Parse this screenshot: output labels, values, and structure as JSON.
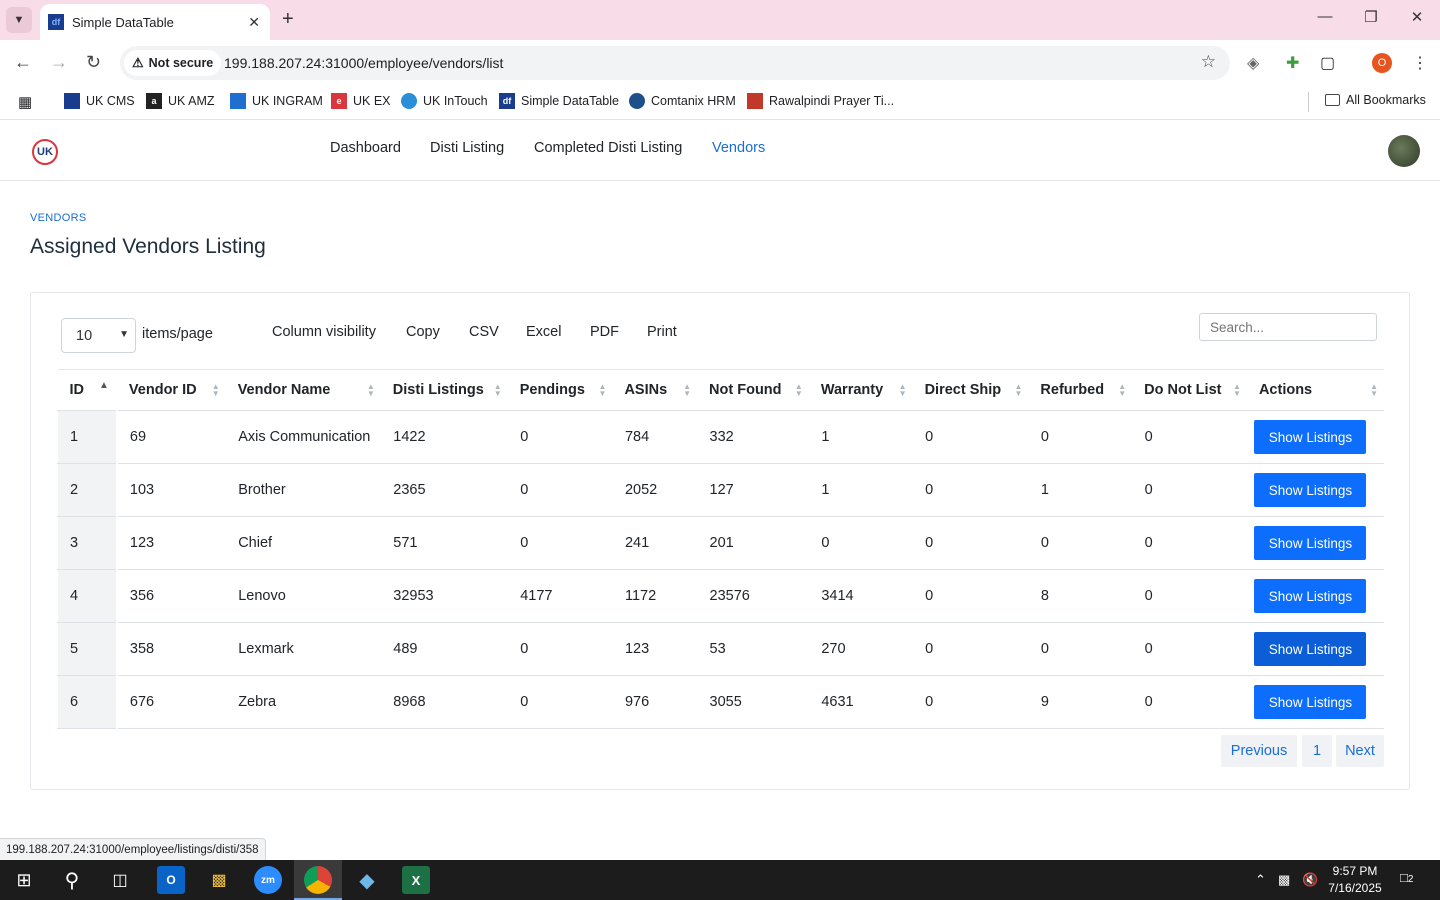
{
  "browser": {
    "tab_title": "Simple DataTable",
    "favicon_text": "df",
    "security_label": "Not secure",
    "url": "199.188.207.24:31000/employee/vendors/list",
    "profile_initial": "O",
    "bookmarks": [
      {
        "label": "UK CMS",
        "color": "#1a3c8c"
      },
      {
        "label": "UK AMZ",
        "color": "#222222"
      },
      {
        "label": "UK INGRAM",
        "color": "#1e6fd0"
      },
      {
        "label": "UK EX",
        "color": "#d9363e"
      },
      {
        "label": "UK InTouch",
        "color": "#2a8fd6"
      },
      {
        "label": "Simple DataTable",
        "color": "#1a3c8c"
      },
      {
        "label": "Comtanix HRM",
        "color": "#1d4f8a"
      },
      {
        "label": "Rawalpindi Prayer Ti...",
        "color": "#c0392b"
      }
    ],
    "all_bookmarks_label": "All Bookmarks",
    "status_url": "199.188.207.24:31000/employee/listings/disti/358"
  },
  "app": {
    "logo_text": "UK",
    "nav": [
      "Dashboard",
      "Disti Listing",
      "Completed Disti Listing",
      "Vendors"
    ],
    "active_nav": "Vendors",
    "accent_color": "#1a6dd6"
  },
  "page": {
    "breadcrumb": "VENDORS",
    "title": "Assigned Vendors Listing"
  },
  "table_controls": {
    "per_page_value": "10",
    "per_page_label": "items/page",
    "tools": [
      "Column visibility",
      "Copy",
      "CSV",
      "Excel",
      "PDF",
      "Print"
    ],
    "search_placeholder": "Search..."
  },
  "table": {
    "columns": [
      "ID",
      "Vendor ID",
      "Vendor Name",
      "Disti Listings",
      "Pendings",
      "ASINs",
      "Not Found",
      "Warranty",
      "Direct Ship",
      "Refurbed",
      "Do Not List",
      "Actions"
    ],
    "rows": [
      [
        "1",
        "69",
        "Axis Communication",
        "1422",
        "0",
        "784",
        "332",
        "1",
        "0",
        "0",
        "0"
      ],
      [
        "2",
        "103",
        "Brother",
        "2365",
        "0",
        "2052",
        "127",
        "1",
        "0",
        "1",
        "0"
      ],
      [
        "3",
        "123",
        "Chief",
        "571",
        "0",
        "241",
        "201",
        "0",
        "0",
        "0",
        "0"
      ],
      [
        "4",
        "356",
        "Lenovo",
        "32953",
        "4177",
        "1172",
        "23576",
        "3414",
        "0",
        "8",
        "0"
      ],
      [
        "5",
        "358",
        "Lexmark",
        "489",
        "0",
        "123",
        "53",
        "270",
        "0",
        "0",
        "0"
      ],
      [
        "6",
        "676",
        "Zebra",
        "8968",
        "0",
        "976",
        "3055",
        "4631",
        "0",
        "9",
        "0"
      ]
    ],
    "action_label": "Show Listings",
    "button_color": "#0d6efd"
  },
  "pagination": {
    "previous": "Previous",
    "current": "1",
    "next": "Next"
  },
  "taskbar": {
    "time": "9:57 PM",
    "date": "7/16/2025",
    "notification_count": "2"
  }
}
